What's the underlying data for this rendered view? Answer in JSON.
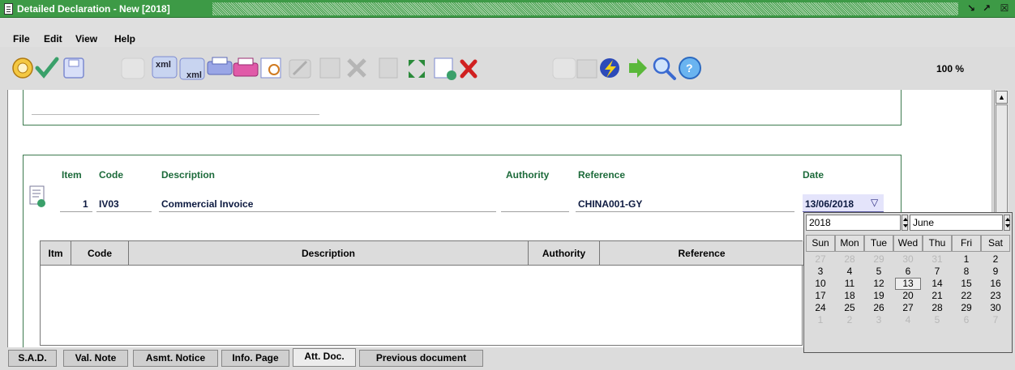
{
  "window": {
    "title": "Detailed Declaration - New [2018]",
    "restore_label": "↘",
    "maximize_label": "↗",
    "close_label": "☒"
  },
  "menu": [
    "File",
    "Edit",
    "View",
    "Help"
  ],
  "toolbar": {
    "icons": [
      "badge-icon",
      "check-icon",
      "save-icon",
      "blank-icon",
      "xml-export-icon",
      "xml-import-icon",
      "print-icon",
      "print-color-icon",
      "print-preview-icon",
      "edit-icon",
      "edit-doc-icon",
      "delete-icon",
      "delete-doc-icon",
      "expand-icon",
      "add-doc-icon",
      "remove-icon",
      "blank-icon",
      "search-doc-icon",
      "flash-icon",
      "forward-icon",
      "zoom-icon",
      "help-icon"
    ],
    "zoom": "100 %"
  },
  "document": {
    "labels": {
      "item": "Item",
      "code": "Code",
      "description": "Description",
      "authority": "Authority",
      "reference": "Reference",
      "date": "Date"
    },
    "row": {
      "item": "1",
      "code": "IV03",
      "description": "Commercial Invoice",
      "authority": "",
      "reference": "CHINA001-GY",
      "date": "13/06/2018"
    },
    "date_dropdown_glyph": "▽"
  },
  "table": {
    "columns": [
      "Itm",
      "Code",
      "Description",
      "Authority",
      "Reference"
    ]
  },
  "calendar": {
    "year": "2018",
    "month": "June",
    "weekdays": [
      "Sun",
      "Mon",
      "Tue",
      "Wed",
      "Thu",
      "Fri",
      "Sat"
    ],
    "days": [
      [
        "27",
        "28",
        "29",
        "30",
        "31",
        "1",
        "2"
      ],
      [
        "3",
        "4",
        "5",
        "6",
        "7",
        "8",
        "9"
      ],
      [
        "10",
        "11",
        "12",
        "13",
        "14",
        "15",
        "16"
      ],
      [
        "17",
        "18",
        "19",
        "20",
        "21",
        "22",
        "23"
      ],
      [
        "24",
        "25",
        "26",
        "27",
        "28",
        "29",
        "30"
      ],
      [
        "1",
        "2",
        "3",
        "4",
        "5",
        "6",
        "7"
      ]
    ],
    "selected": "13"
  },
  "tabs": [
    "S.A.D.",
    "Val. Note",
    "Asmt. Notice",
    "Info. Page",
    "Att. Doc.",
    "Previous document"
  ],
  "active_tab": "Att. Doc.",
  "colors": {
    "title_green": "#3d9a46",
    "label_green": "#1c6a3a",
    "date_bg": "#e4e4fb"
  }
}
